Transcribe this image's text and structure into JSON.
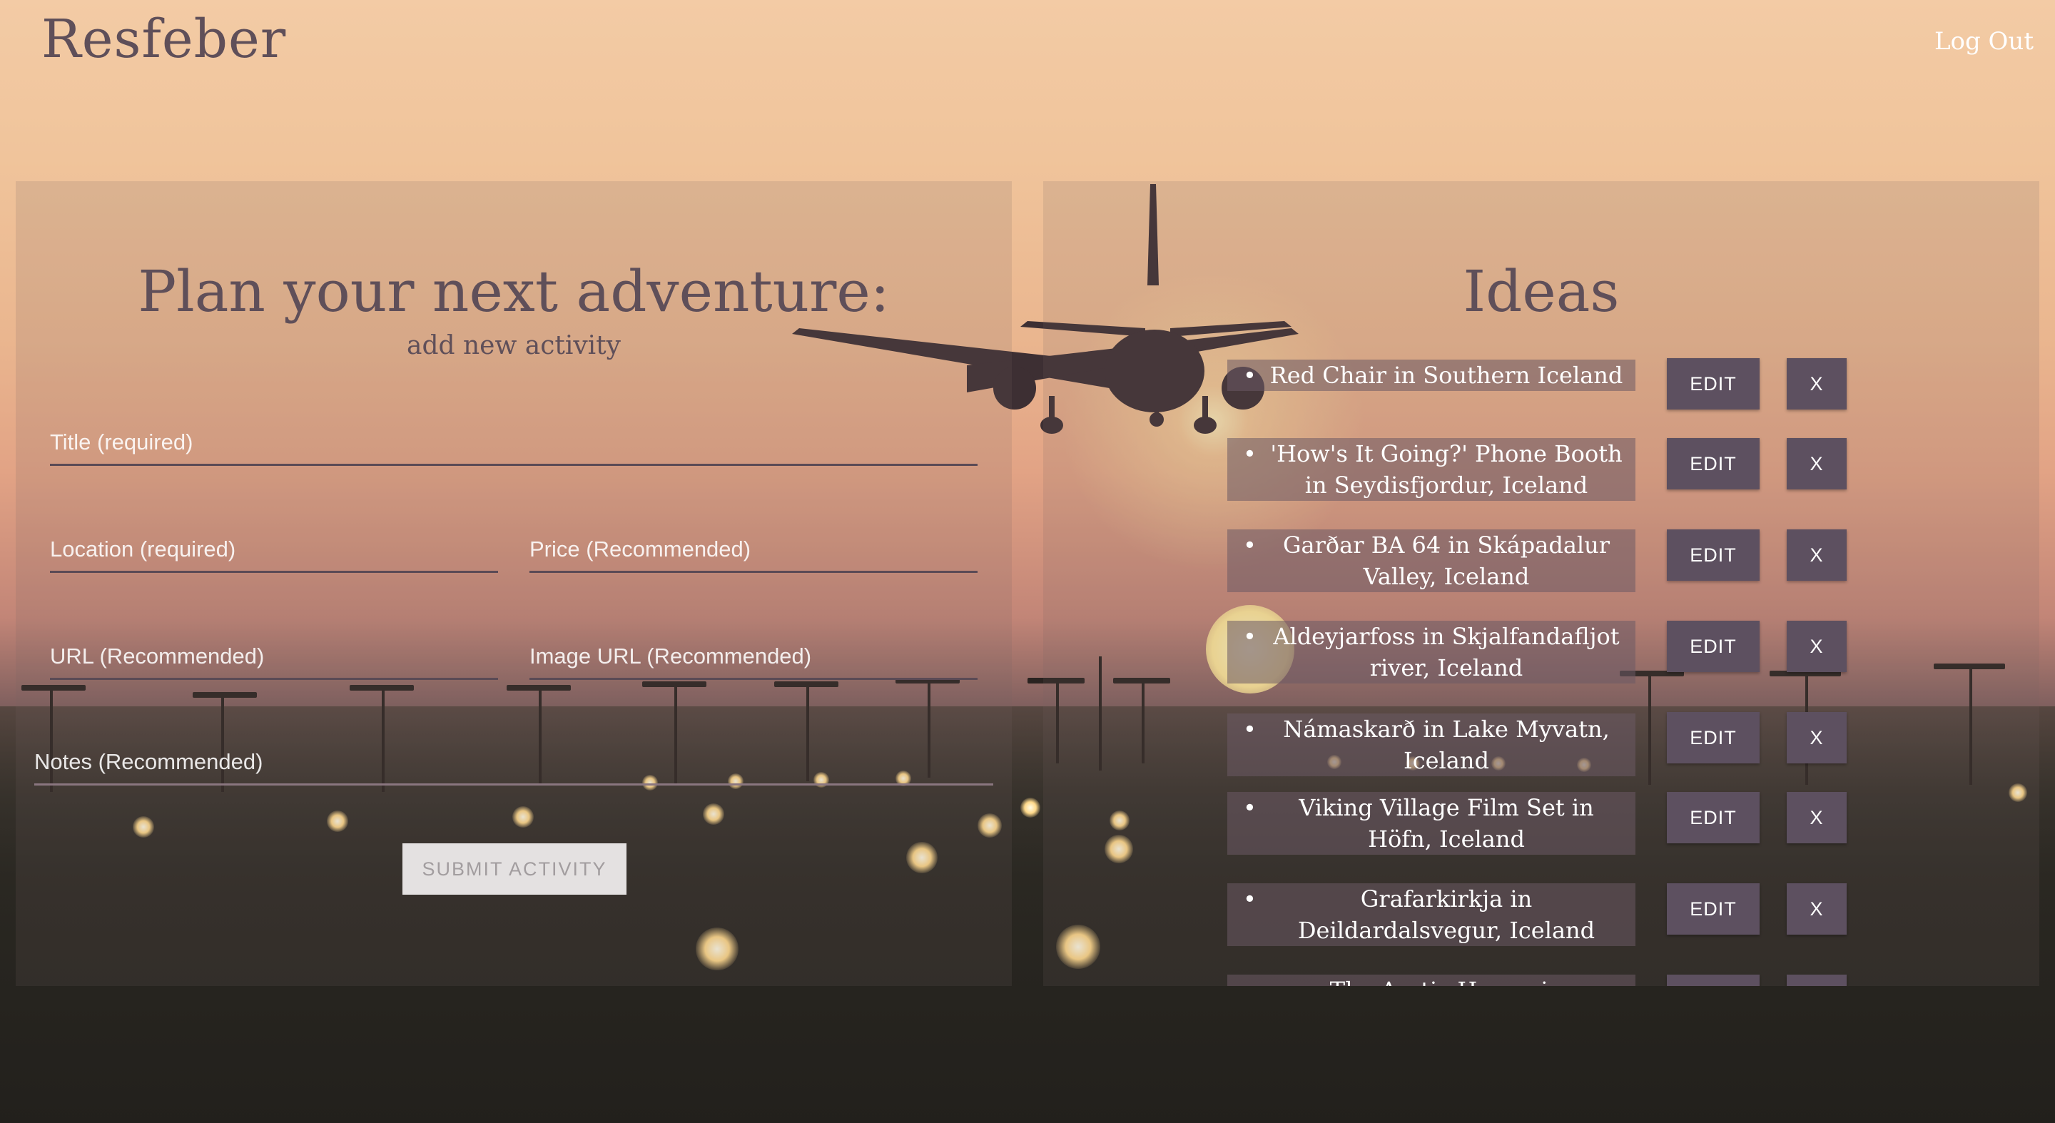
{
  "header": {
    "logo": "Resfeber",
    "logout_label": "Log Out"
  },
  "form": {
    "title": "Plan your next adventure:",
    "subtitle": "add new activity",
    "title_placeholder": "Title (required)",
    "location_placeholder": "Location (required)",
    "price_placeholder": "Price (Recommended)",
    "url_placeholder": "URL (Recommended)",
    "image_url_placeholder": "Image URL (Recommended)",
    "notes_placeholder": "Notes (Recommended)",
    "submit_label": "SUBMIT ACTIVITY"
  },
  "ideas": {
    "title": "Ideas",
    "edit_label": "EDIT",
    "delete_label": "X",
    "items": [
      {
        "text": "Red Chair in Southern Iceland"
      },
      {
        "text": "'How's It Going?' Phone Booth in Seydisfjordur, Iceland"
      },
      {
        "text": "Garðar BA 64 in Skápadalur Valley, Iceland"
      },
      {
        "text": "Aldeyjarfoss in Skjalfandafljot river, Iceland"
      },
      {
        "text": "Námaskarð in Lake Myvatn, Iceland"
      },
      {
        "text": "Viking Village Film Set in Höfn, Iceland"
      },
      {
        "text": "Grafarkirkja in Deildardalsvegur, Iceland"
      },
      {
        "text": "The Arctic Henge in Raufarhöfn"
      }
    ]
  },
  "colors": {
    "brand": "#5f4f59",
    "button": "#5d5060",
    "submit_disabled": "#e4e1e1"
  },
  "icons": {
    "background": "airplane-landing-sunset"
  }
}
